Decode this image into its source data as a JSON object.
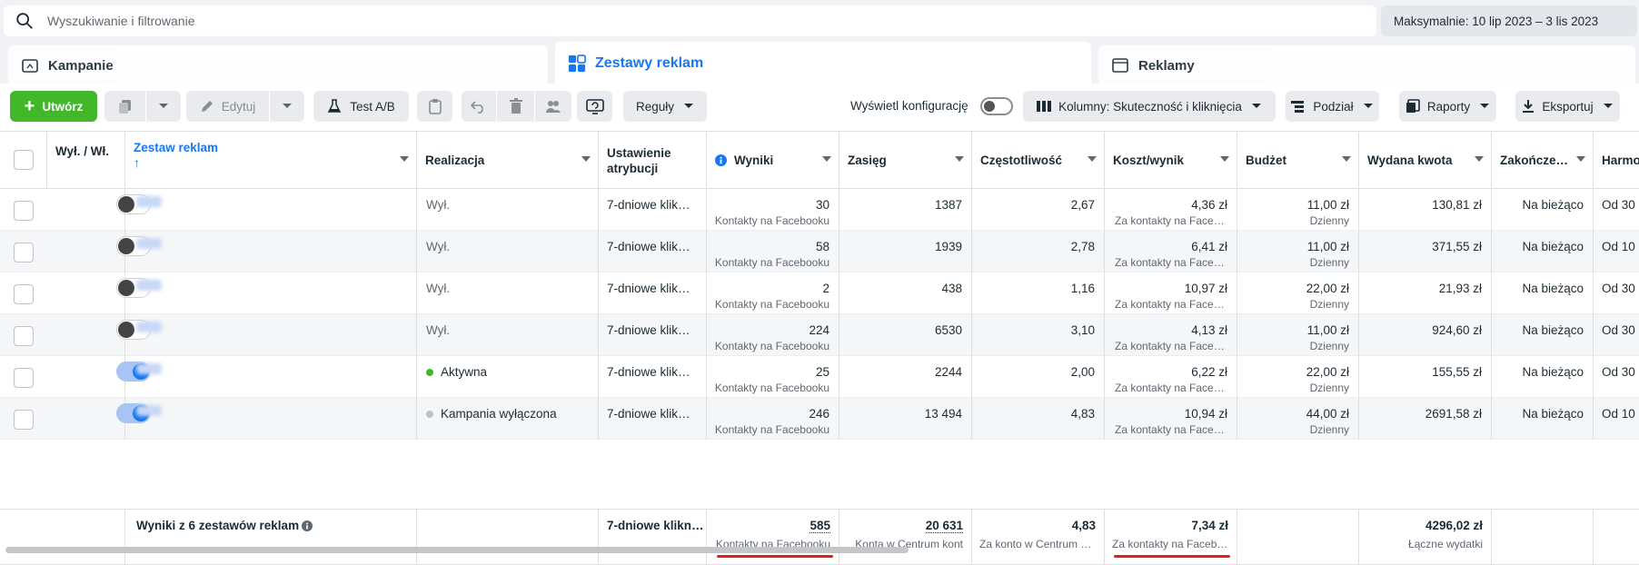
{
  "search": {
    "placeholder": "Wyszukiwanie i filtrowanie"
  },
  "date_range": "Maksymalnie: 10 lip 2023 – 3 lis 2023",
  "tabs": [
    {
      "label": "Kampanie"
    },
    {
      "label": "Zestawy reklam"
    },
    {
      "label": "Reklamy"
    }
  ],
  "toolbar": {
    "create": "Utwórz",
    "edit": "Edytuj",
    "ab_test": "Test A/B",
    "rules": "Reguły",
    "show_config": "Wyświetl konfigurację",
    "columns": "Kolumny: Skuteczność i kliknięcia",
    "breakdown": "Podział",
    "reports": "Raporty",
    "export": "Eksportuj"
  },
  "columns": [
    "Wył. / Wł.",
    "Zestaw reklam",
    "Realizacja",
    "Ustawienie atrybucji",
    "Wyniki",
    "Zasięg",
    "Częstotliwość",
    "Koszt/wynik",
    "Budżet",
    "Wydana kwota",
    "Zakończe…",
    "Harmo"
  ],
  "sort_arrow": "↑",
  "rows": [
    {
      "on": false,
      "delivery": "Wył.",
      "delivery_dot": "",
      "attribution": "7-dniowe klik…",
      "results": "30",
      "results_sub": "Kontakty na Facebooku",
      "reach": "1387",
      "frequency": "2,67",
      "cost": "4,36 zł",
      "cost_sub": "Za kontakty na Facebooku",
      "budget": "11,00 zł",
      "budget_sub": "Dzienny",
      "spent": "130,81 zł",
      "end": "Na bieżąco",
      "schedule": "Od 30"
    },
    {
      "on": false,
      "delivery": "Wył.",
      "delivery_dot": "",
      "attribution": "7-dniowe klik…",
      "results": "58",
      "results_sub": "Kontakty na Facebooku",
      "reach": "1939",
      "frequency": "2,78",
      "cost": "6,41 zł",
      "cost_sub": "Za kontakty na Facebooku",
      "budget": "11,00 zł",
      "budget_sub": "Dzienny",
      "spent": "371,55 zł",
      "end": "Na bieżąco",
      "schedule": "Od 10"
    },
    {
      "on": false,
      "delivery": "Wył.",
      "delivery_dot": "",
      "attribution": "7-dniowe klik…",
      "results": "2",
      "results_sub": "Kontakty na Facebooku",
      "reach": "438",
      "frequency": "1,16",
      "cost": "10,97 zł",
      "cost_sub": "Za kontakty na Facebooku",
      "budget": "22,00 zł",
      "budget_sub": "Dzienny",
      "spent": "21,93 zł",
      "end": "Na bieżąco",
      "schedule": "Od 30"
    },
    {
      "on": false,
      "delivery": "Wył.",
      "delivery_dot": "",
      "attribution": "7-dniowe klik…",
      "results": "224",
      "results_sub": "Kontakty na Facebooku",
      "reach": "6530",
      "frequency": "3,10",
      "cost": "4,13 zł",
      "cost_sub": "Za kontakty na Facebooku",
      "budget": "11,00 zł",
      "budget_sub": "Dzienny",
      "spent": "924,60 zł",
      "end": "Na bieżąco",
      "schedule": "Od 30"
    },
    {
      "on": true,
      "delivery": "Aktywna",
      "delivery_dot": "#42b72a",
      "attribution": "7-dniowe klik…",
      "results": "25",
      "results_sub": "Kontakty na Facebooku",
      "reach": "2244",
      "frequency": "2,00",
      "cost": "6,22 zł",
      "cost_sub": "Za kontakty na Facebooku",
      "budget": "22,00 zł",
      "budget_sub": "Dzienny",
      "spent": "155,55 zł",
      "end": "Na bieżąco",
      "schedule": "Od 30"
    },
    {
      "on": true,
      "delivery": "Kampania wyłączona",
      "delivery_dot": "#bec3c9",
      "attribution": "7-dniowe klik…",
      "results": "246",
      "results_sub": "Kontakty na Facebooku",
      "reach": "13 494",
      "frequency": "4,83",
      "cost": "10,94 zł",
      "cost_sub": "Za kontakty na Facebooku",
      "budget": "44,00 zł",
      "budget_sub": "Dzienny",
      "spent": "2691,58 zł",
      "end": "Na bieżąco",
      "schedule": "Od 10"
    }
  ],
  "totals": {
    "label": "Wyniki z 6 zestawów reklam",
    "attribution": "7-dniowe klikn…",
    "results": "585",
    "results_sub": "Kontakty na Facebooku",
    "reach": "20 631",
    "reach_sub": "Konta w Centrum kont",
    "frequency": "4,83",
    "frequency_sub": "Za konto w Centrum kont",
    "cost": "7,34 zł",
    "cost_sub": "Za kontakty na Facebooku",
    "spent": "4296,02 zł",
    "spent_sub": "Łączne wydatki"
  },
  "colors": {
    "accent": "#1877f2",
    "create": "#42b72a",
    "underline": "#e0201f"
  }
}
